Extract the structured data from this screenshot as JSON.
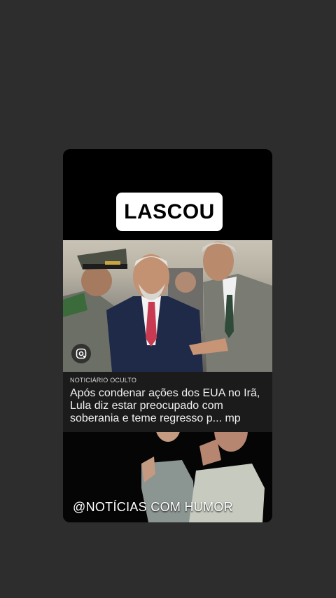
{
  "post": {
    "headline": "LASCOU",
    "source": "NOTICIÁRIO OCULTO",
    "story_text": "Após condenar ações dos EUA no Irã, Lula diz estar preocupado com soberania e teme regresso p... mp",
    "watermark": "@NOTÍCIAS COM HUMOR"
  },
  "colors": {
    "background": "#2d2d2d",
    "card": "#000000",
    "caption_bar": "#1b1b1b",
    "headline_box": "#ffffff"
  },
  "icons": {
    "lens": "google-lens-icon"
  }
}
